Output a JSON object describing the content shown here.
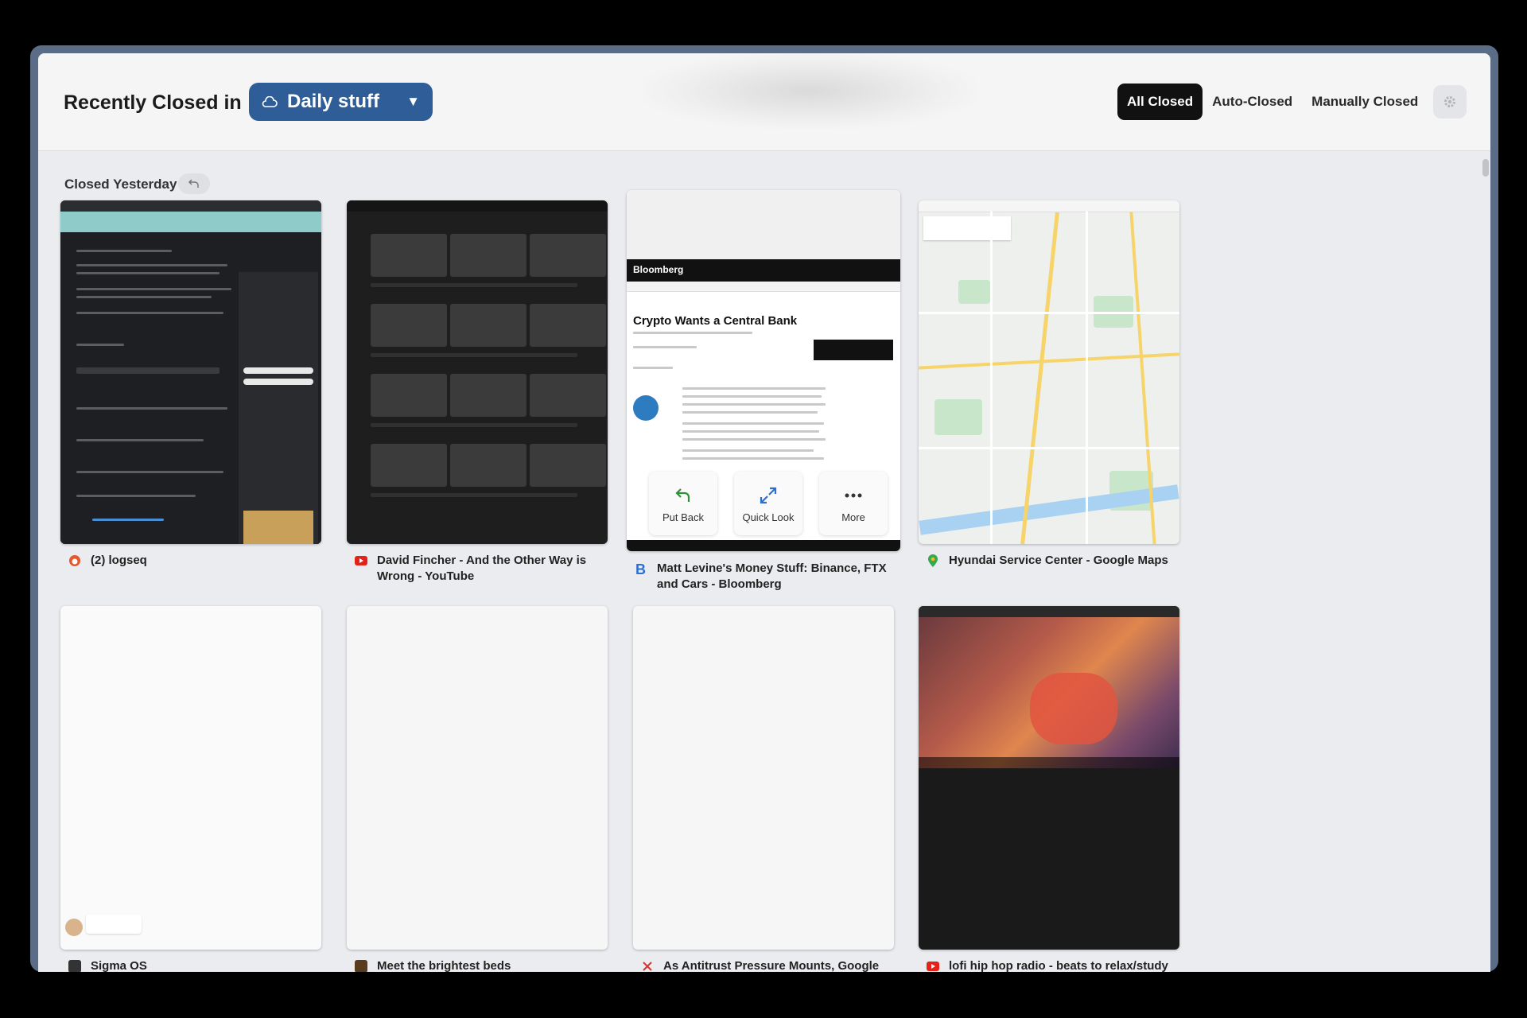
{
  "header": {
    "title": "Recently Closed in",
    "space_name": "Daily stuff",
    "filters": [
      "All Closed",
      "Auto-Closed",
      "Manually Closed"
    ],
    "active_filter": "All Closed"
  },
  "section": {
    "label": "Closed Yesterday"
  },
  "tabs": [
    {
      "title": "(2) logseq",
      "favicon": "logseq-icon"
    },
    {
      "title": "David Fincher - And the Other Way is Wrong - YouTube",
      "favicon": "youtube-icon"
    },
    {
      "title": "Matt Levine's Money Stuff: Binance, FTX and Cars - Bloomberg",
      "favicon": "bloomberg-icon"
    },
    {
      "title": "Hyundai Service Center - Google Maps",
      "favicon": "google-maps-icon"
    },
    {
      "title": "Sigma OS",
      "favicon": "sigma-icon"
    },
    {
      "title": "Meet the brightest beds",
      "favicon": "page-icon"
    },
    {
      "title": "As Antitrust Pressure Mounts, Google",
      "favicon": "news-icon"
    },
    {
      "title": "lofi hip hop radio - beats to relax/study",
      "favicon": "youtube-icon"
    }
  ],
  "thumb_text": {
    "bloomberg_brand": "Bloomberg",
    "bloomberg_headline": "Crypto Wants a Central Bank"
  },
  "hover_actions": {
    "put_back": "Put Back",
    "quick_look": "Quick Look",
    "more": "More"
  },
  "colors": {
    "accent": "#2e5d97",
    "active_filter_bg": "#111111",
    "window_frame": "#5b6c86"
  }
}
